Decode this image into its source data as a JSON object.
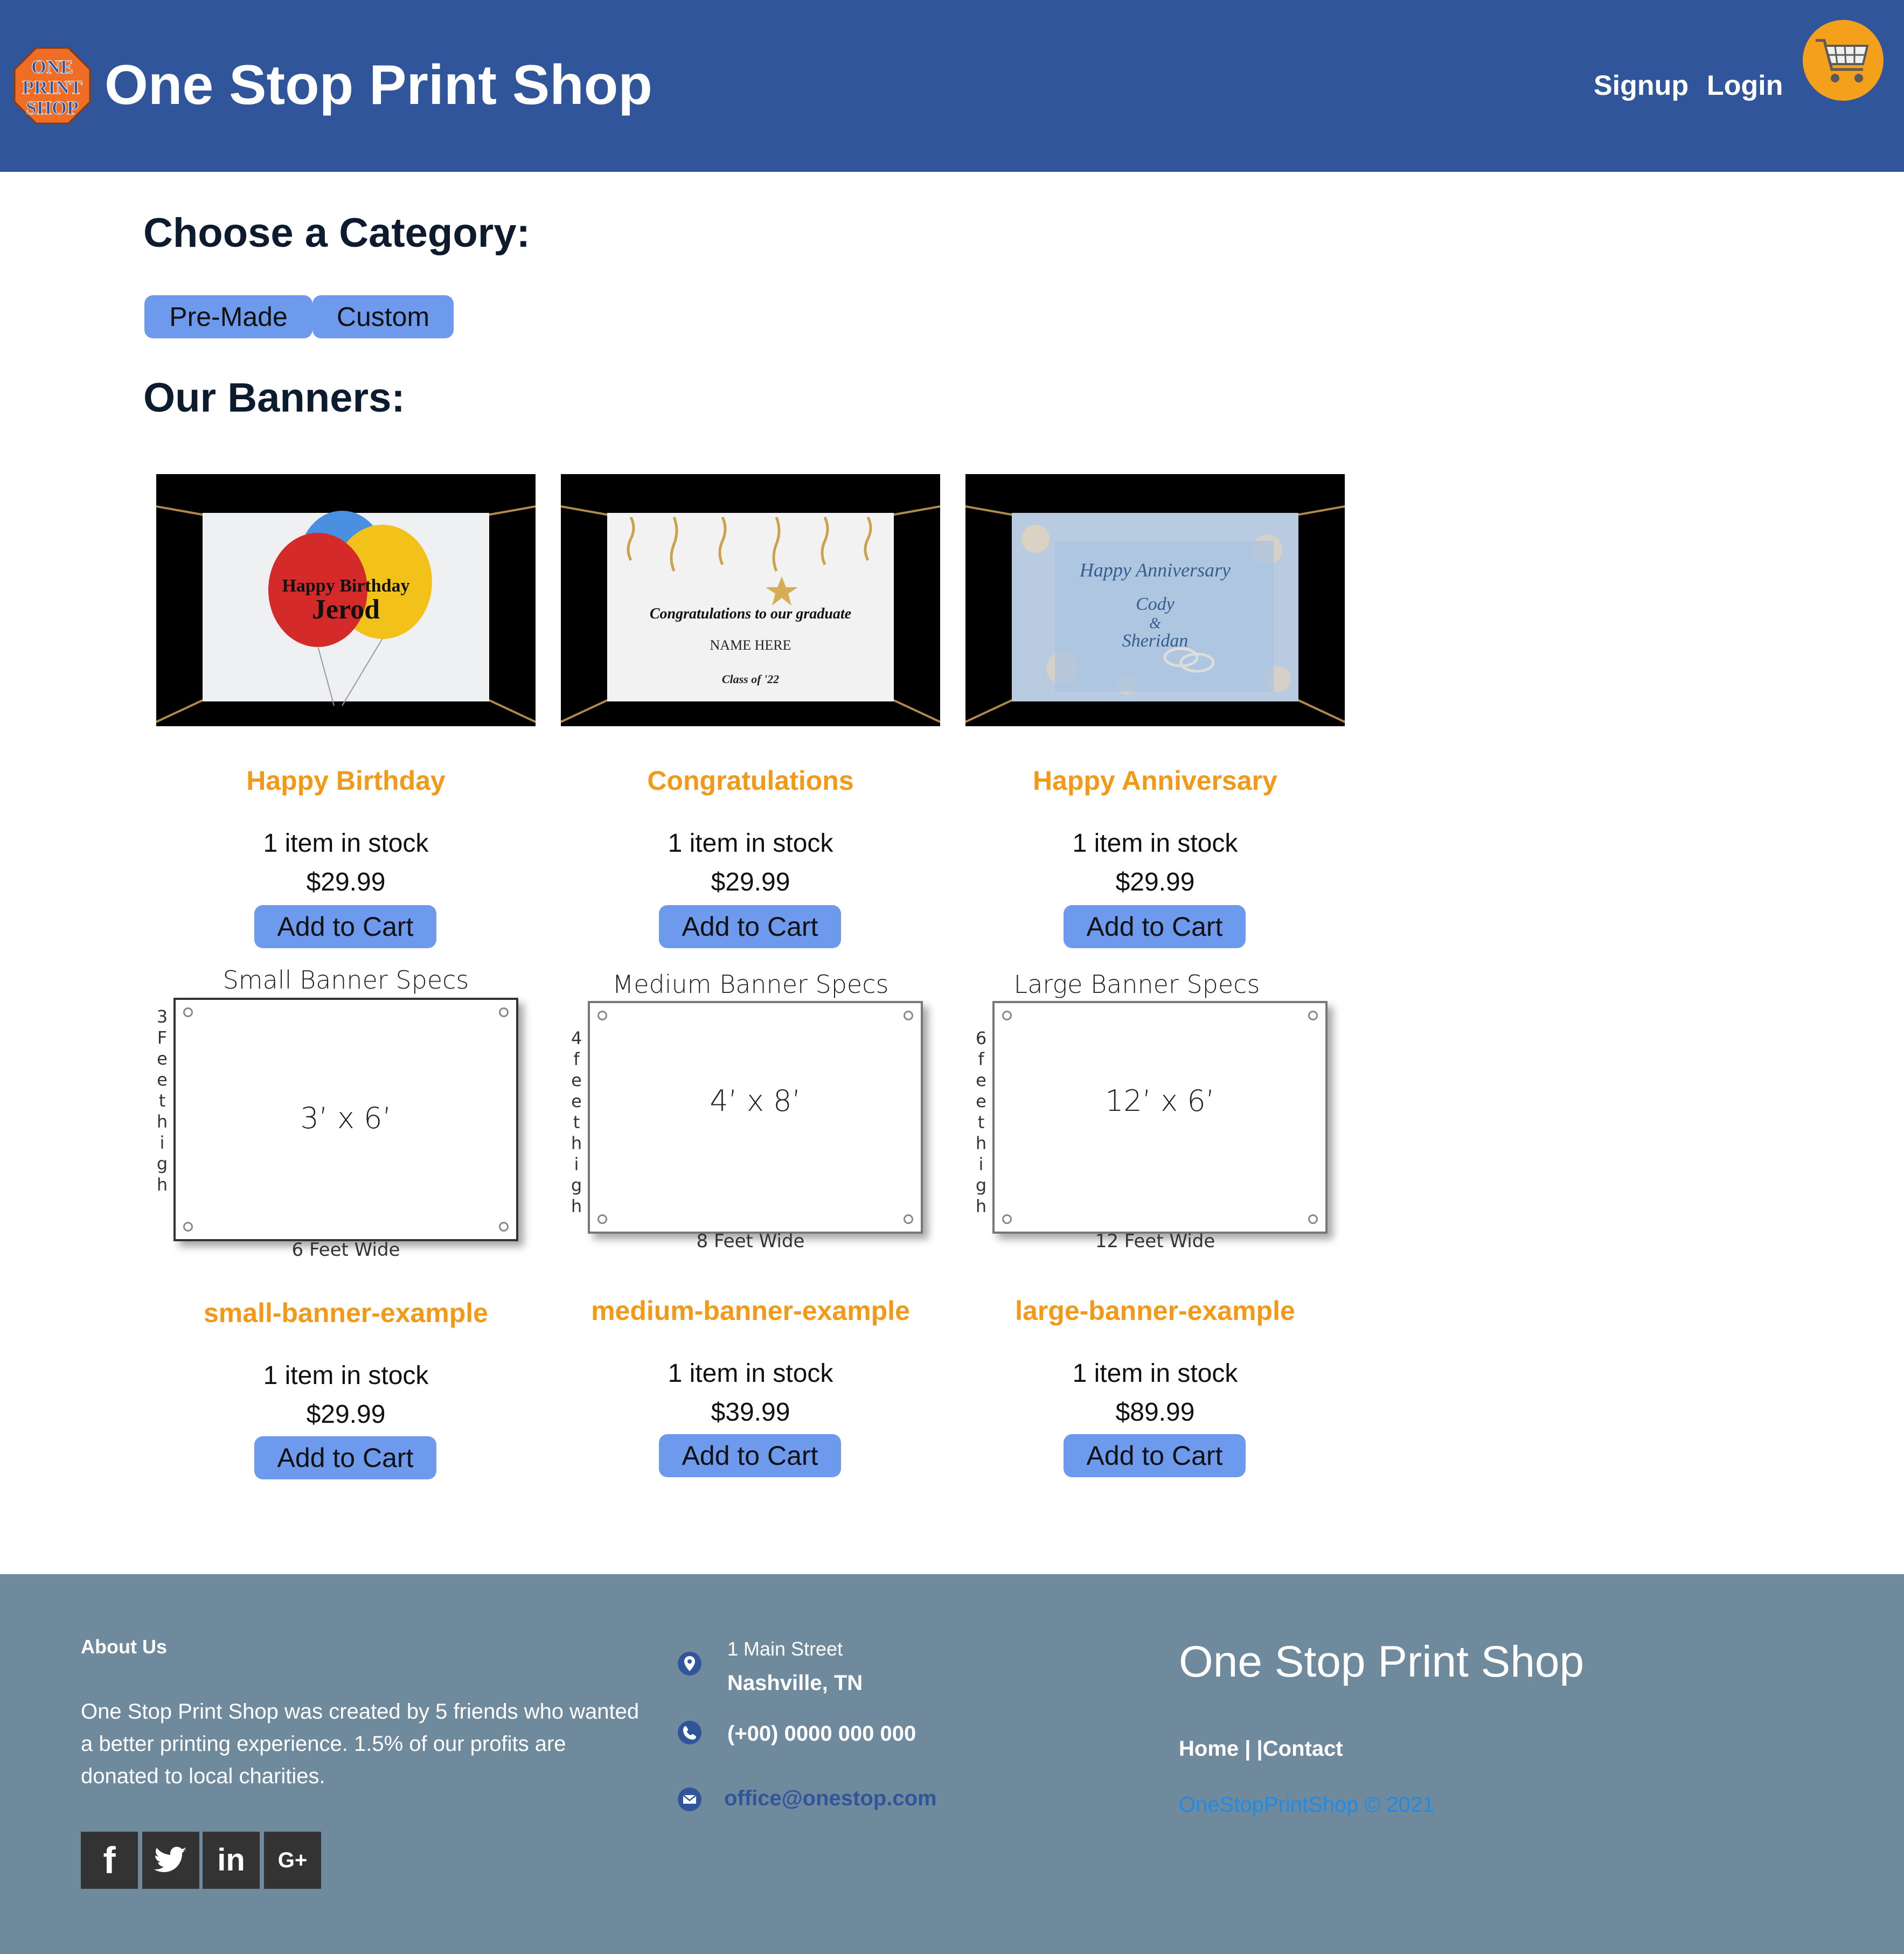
{
  "header": {
    "logo_text": [
      "ONE",
      "PRINT",
      "SHOP"
    ],
    "title": "One Stop Print Shop",
    "nav": {
      "signup": "Signup",
      "login": "Login"
    },
    "cart_icon": "shopping-cart-icon"
  },
  "main": {
    "category_heading": "Choose a Category:",
    "categories": [
      {
        "label": "Pre-Made"
      },
      {
        "label": "Custom"
      }
    ],
    "banners_heading": "Our Banners:",
    "products": [
      {
        "name": "Happy Birthday",
        "stock": "1 item in stock",
        "price": "$29.99",
        "button": "Add to Cart",
        "image_text": {
          "line1": "Happy Birthday",
          "line2": "Jerod"
        }
      },
      {
        "name": "Congratulations",
        "stock": "1 item in stock",
        "price": "$29.99",
        "button": "Add to Cart",
        "image_text": {
          "line1": "Congratulations to our graduate",
          "line2": "NAME HERE",
          "line3": "Class of '22"
        }
      },
      {
        "name": "Happy Anniversary",
        "stock": "1 item in stock",
        "price": "$29.99",
        "button": "Add to Cart",
        "image_text": {
          "line1": "Happy Anniversary",
          "line2": "Cody",
          "line3": "&",
          "line4": "Sheridan"
        }
      },
      {
        "name": "small-banner-example",
        "stock": "1 item in stock",
        "price": "$29.99",
        "button": "Add to Cart",
        "spec": {
          "title": "Small Banner Specs",
          "dims": "3’ x 6’",
          "height": "3 Feet high",
          "width": "6 Feet Wide"
        }
      },
      {
        "name": "medium-banner-example",
        "stock": "1 item in stock",
        "price": "$39.99",
        "button": "Add to Cart",
        "spec": {
          "title": "Medium Banner Specs",
          "dims": "4’ x 8’",
          "height": "4 feet high",
          "width": "8 Feet Wide"
        }
      },
      {
        "name": "large-banner-example",
        "stock": "1 item in stock",
        "price": "$89.99",
        "button": "Add to Cart",
        "spec": {
          "title": "Large Banner Specs",
          "dims": "12’ x 6’",
          "height": "6 feet high",
          "width": "12 Feet Wide"
        }
      }
    ]
  },
  "footer": {
    "about_heading": "About Us",
    "about_text": "One Stop Print Shop was created by 5 friends who wanted a better printing experience. 1.5% of our profits are donated to local charities.",
    "social": [
      {
        "icon": "facebook-icon",
        "glyph": "f"
      },
      {
        "icon": "twitter-icon",
        "glyph": "t"
      },
      {
        "icon": "linkedin-icon",
        "glyph": "in"
      },
      {
        "icon": "google-plus-icon",
        "glyph": "G+"
      }
    ],
    "address_line1": "1 Main Street",
    "address_line2": "Nashville, TN",
    "phone": "(+00) 0000 000 000",
    "email": "office@onestop.com",
    "brand": "One Stop Print Shop",
    "links": "Home | |Contact",
    "copyright": "OneStopPrintShop © 2021"
  },
  "colors": {
    "header_bg": "#30559b",
    "accent_orange": "#f29a18",
    "button_blue": "#6d9aed",
    "footer_bg": "#708a9d",
    "link_blue": "#1d8ce8"
  }
}
